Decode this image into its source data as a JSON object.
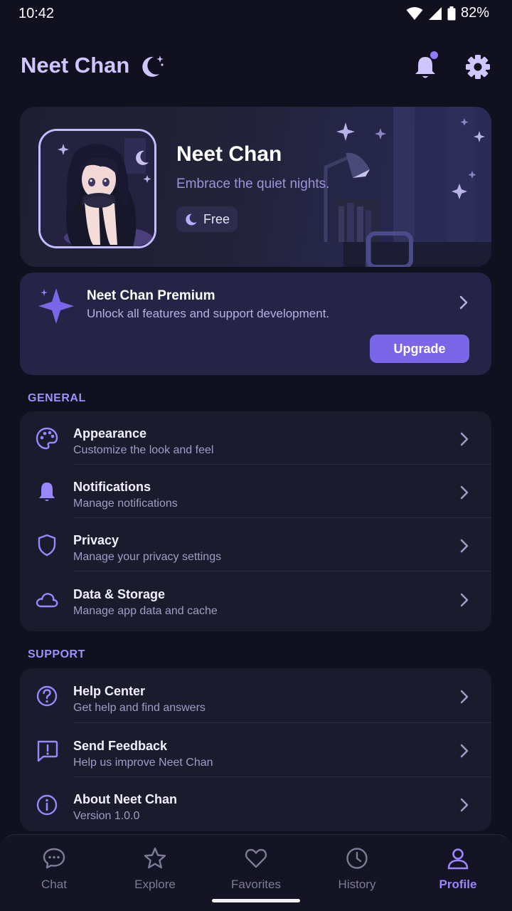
{
  "status_bar": {
    "time": "10:42",
    "battery": "82%"
  },
  "header": {
    "title": "Neet Chan"
  },
  "profile": {
    "name": "Neet Chan",
    "tagline": "Embrace the quiet nights.",
    "plan": "Free"
  },
  "premium": {
    "title": "Neet Chan Premium",
    "subtitle": "Unlock all features and support development.",
    "button": "Upgrade"
  },
  "general": {
    "label": "GENERAL",
    "items": [
      {
        "title": "Appearance",
        "subtitle": "Customize the look and feel",
        "icon": "palette-icon"
      },
      {
        "title": "Notifications",
        "subtitle": "Manage notifications",
        "icon": "bell-icon"
      },
      {
        "title": "Privacy",
        "subtitle": "Manage your privacy settings",
        "icon": "shield-icon"
      },
      {
        "title": "Data & Storage",
        "subtitle": "Manage app data and cache",
        "icon": "cloud-icon"
      }
    ]
  },
  "support": {
    "label": "SUPPORT",
    "items": [
      {
        "title": "Help Center",
        "subtitle": "Get help and find answers",
        "icon": "help-icon"
      },
      {
        "title": "Send Feedback",
        "subtitle": "Help us improve Neet Chan",
        "icon": "feedback-icon"
      },
      {
        "title": "About Neet Chan",
        "subtitle": "Version 1.0.0",
        "icon": "info-icon"
      }
    ]
  },
  "nav": {
    "items": [
      {
        "label": "Chat",
        "icon": "chat-icon"
      },
      {
        "label": "Explore",
        "icon": "star-icon"
      },
      {
        "label": "Favorites",
        "icon": "heart-icon"
      },
      {
        "label": "History",
        "icon": "clock-icon"
      },
      {
        "label": "Profile",
        "icon": "user-icon",
        "active": true
      }
    ]
  },
  "colors": {
    "background": "#10101e",
    "accent": "#7a66e6",
    "accent_light": "#9a86ff",
    "card": "#1b1b2e"
  }
}
